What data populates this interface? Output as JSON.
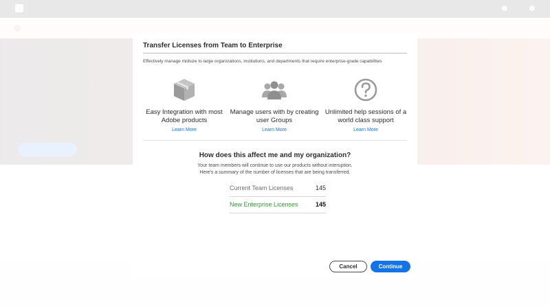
{
  "modal": {
    "title": "Transfer Licenses from Team to Enterprise",
    "description": "Effectively manage midsize to large organizations, institutions, and departments that require enterprise-grade capabilities",
    "features": [
      {
        "icon": "package-box-icon",
        "label": "Easy Integration with most Adobe products",
        "link": "Learn More"
      },
      {
        "icon": "user-group-icon",
        "label": "Manage users with by creating user Groups",
        "link": "Learn More"
      },
      {
        "icon": "help-question-icon",
        "label": "Unlimited help sessions of a world class support",
        "link": "Learn More"
      }
    ],
    "question": "How does this affect me and my organization?",
    "explanation_line1": "Your team members will continue to use our products without interuption.",
    "explanation_line2": "Here's a summary of the number of licenses that are being transferred.",
    "licenses": {
      "current_label": "Current Team Licenses",
      "current_value": "145",
      "new_label": "New Enterprise Licenses",
      "new_value": "145"
    },
    "buttons": {
      "cancel": "Cancel",
      "continue": "Continue"
    }
  },
  "colors": {
    "accent": "#1473e6",
    "success_text": "#2d9d2d"
  }
}
